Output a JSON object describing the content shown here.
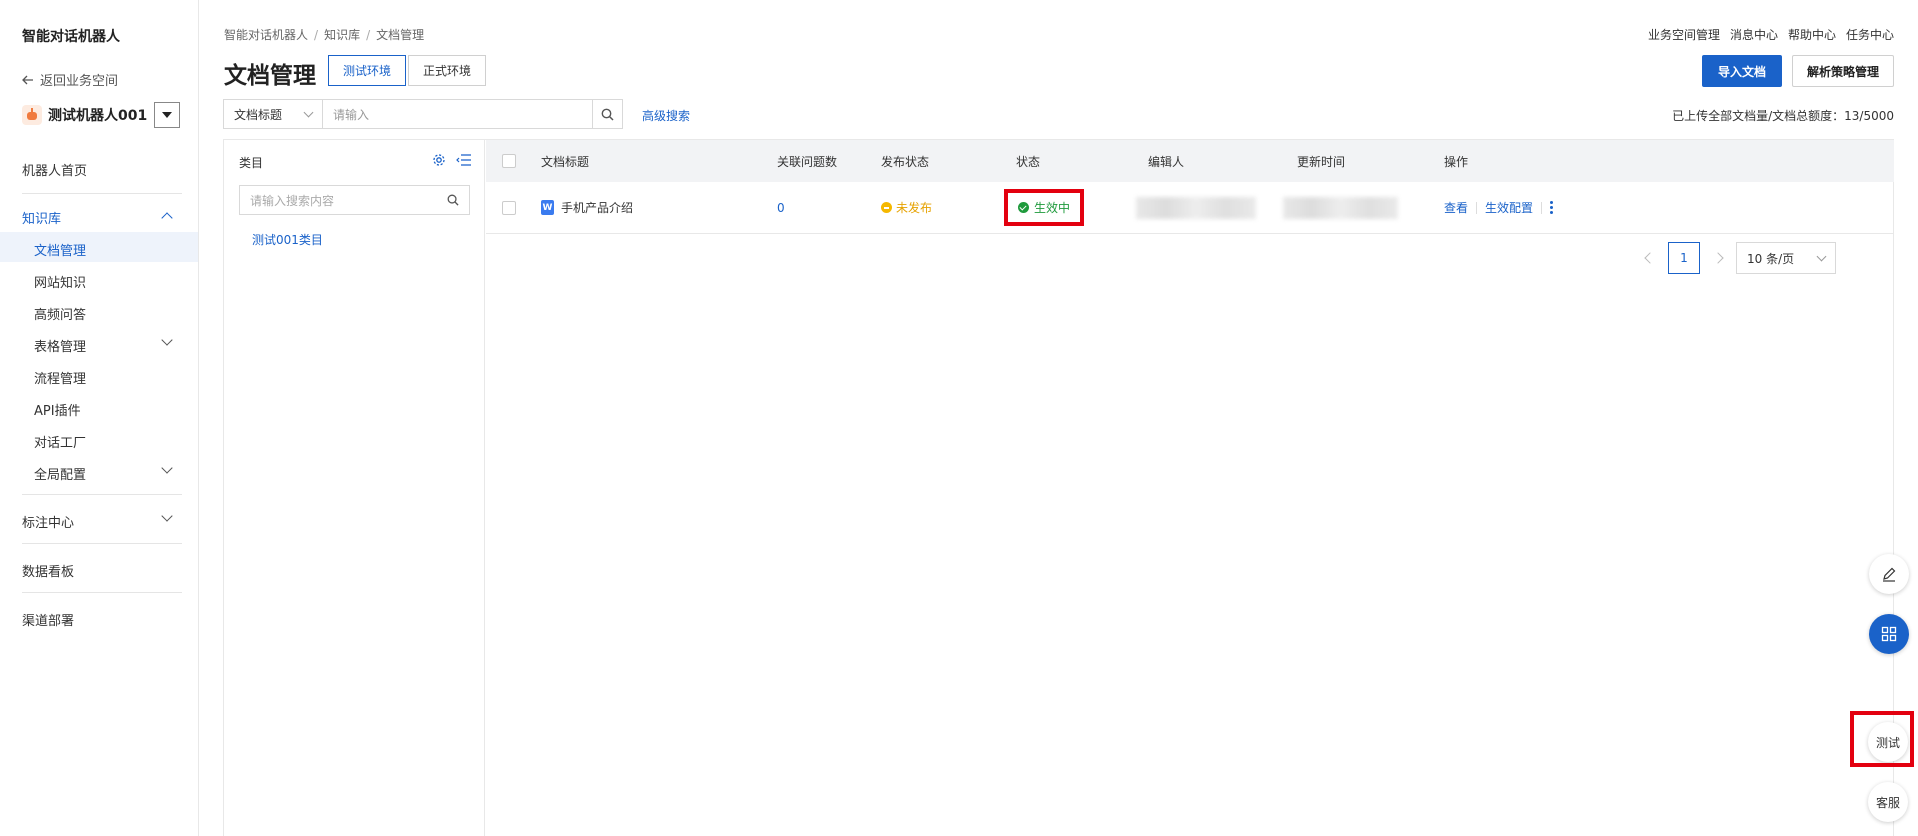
{
  "sidebar": {
    "app_title": "智能对话机器人",
    "back_label": "返回业务空间",
    "robot_name": "测试机器人001",
    "items": {
      "home": "机器人首页",
      "kb": "知识库",
      "kb_sub": [
        "文档管理",
        "网站知识",
        "高频问答",
        "表格管理",
        "流程管理",
        "API插件",
        "对话工厂",
        "全局配置"
      ],
      "annotation": "标注中心",
      "dashboard": "数据看板",
      "deploy": "渠道部署"
    }
  },
  "header": {
    "breadcrumb": [
      "智能对话机器人",
      "知识库",
      "文档管理"
    ],
    "top_links": [
      "业务空间管理",
      "消息中心",
      "帮助中心",
      "任务中心"
    ],
    "page_title": "文档管理",
    "env_tabs": [
      "测试环境",
      "正式环境"
    ],
    "import_btn": "导入文档",
    "strategy_btn": "解析策略管理"
  },
  "search": {
    "field": "文档标题",
    "placeholder": "请输入",
    "advanced": "高级搜索",
    "quota": "已上传全部文档量/文档总额度：13/5000"
  },
  "category": {
    "title": "类目",
    "search_placeholder": "请输入搜索内容",
    "items": [
      "测试001类目"
    ]
  },
  "table": {
    "columns": [
      "文档标题",
      "关联问题数",
      "发布状态",
      "状态",
      "编辑人",
      "更新时间",
      "操作"
    ],
    "rows": [
      {
        "title": "手机产品介绍",
        "related": "0",
        "publish": "未发布",
        "status": "生效中",
        "ops": [
          "查看",
          "生效配置"
        ]
      }
    ]
  },
  "pager": {
    "page": "1",
    "size": "10 条/页"
  },
  "floating": {
    "test": "测试",
    "service": "客服"
  },
  "colors": {
    "accent": "#1a62c9",
    "success": "#1f9a3c",
    "warning": "#f5b800",
    "highlight": "#e3000f"
  }
}
